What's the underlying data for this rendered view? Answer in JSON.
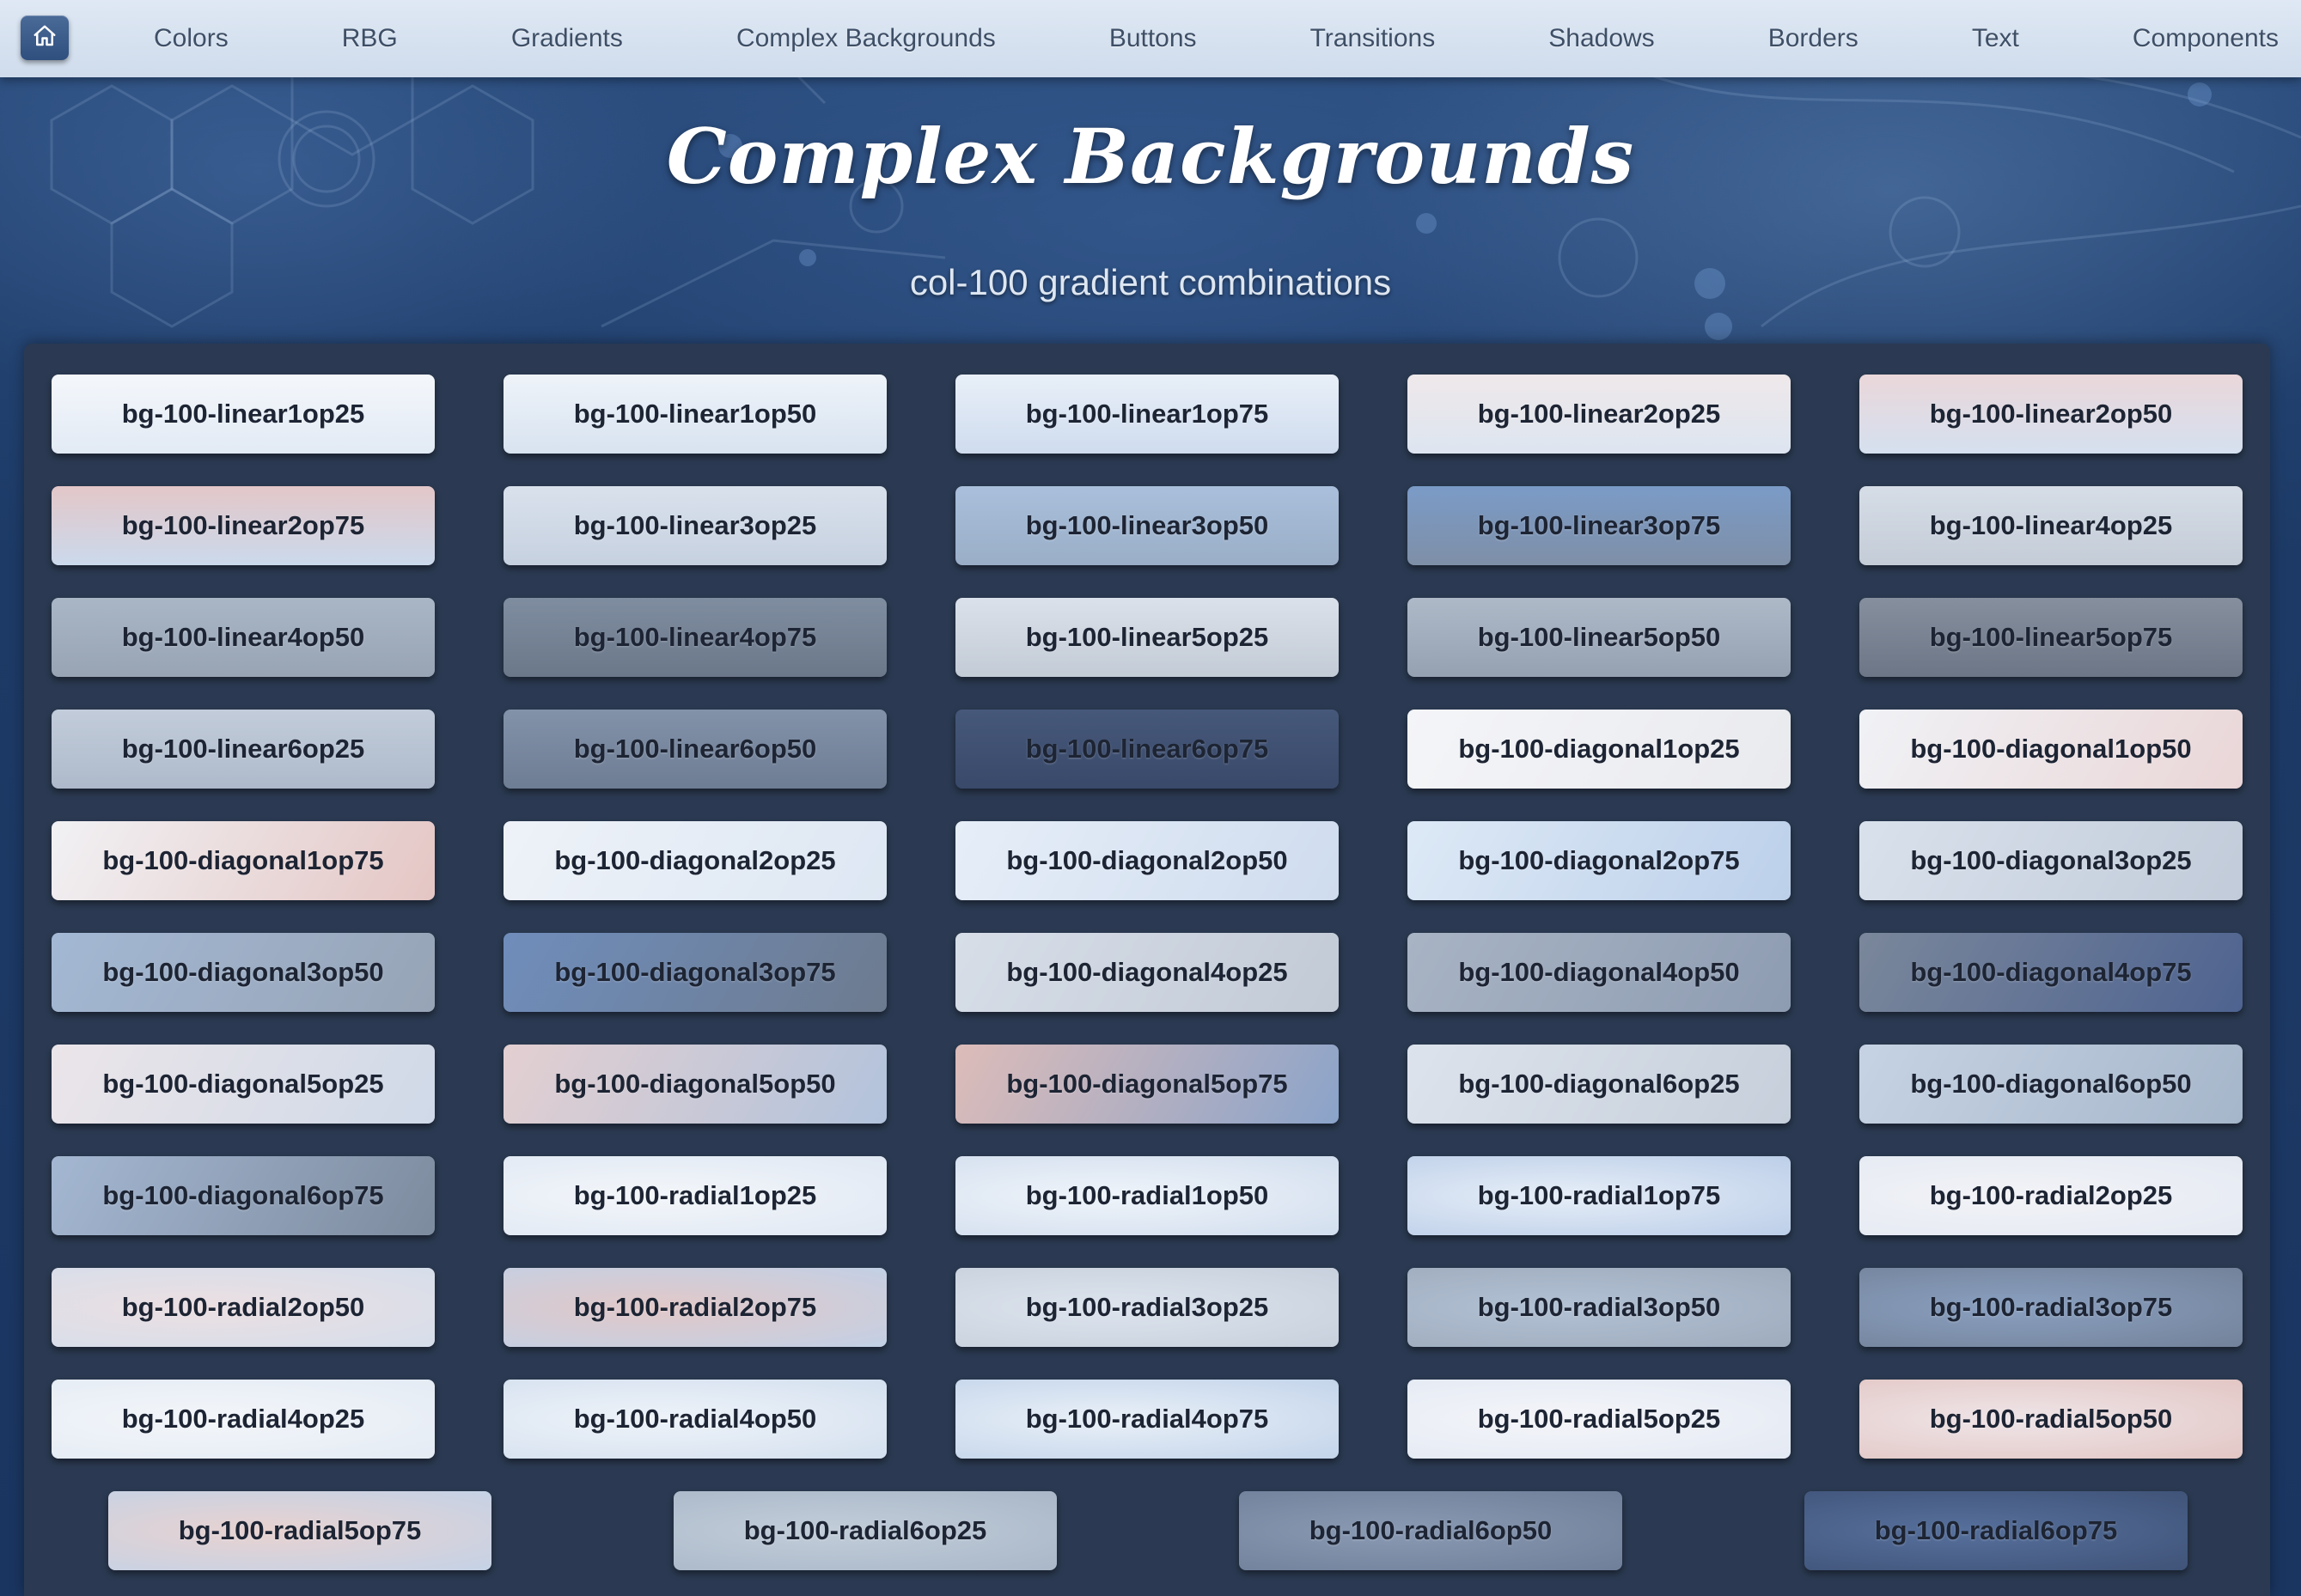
{
  "nav": {
    "home_icon": "home-icon",
    "items": [
      {
        "label": "Colors"
      },
      {
        "label": "RBG"
      },
      {
        "label": "Gradients"
      },
      {
        "label": "Complex Backgrounds"
      },
      {
        "label": "Buttons"
      },
      {
        "label": "Transitions"
      },
      {
        "label": "Shadows"
      },
      {
        "label": "Borders"
      },
      {
        "label": "Text"
      },
      {
        "label": "Components"
      }
    ]
  },
  "header": {
    "title": "Complex Backgrounds",
    "subtitle": "col-100 gradient combinations"
  },
  "colors": {
    "nav_bg": "#dfe8f4",
    "panel_bg": "#2b3a52",
    "page_bg": "#1f3a64"
  },
  "tiles": [
    {
      "label": "bg-100-linear1op25",
      "c1": "#f4f7fb",
      "c2": "#e2eaf4",
      "type": "linear"
    },
    {
      "label": "bg-100-linear1op50",
      "c1": "#eef3f9",
      "c2": "#d8e3f0",
      "type": "linear"
    },
    {
      "label": "bg-100-linear1op75",
      "c1": "#e8eff8",
      "c2": "#cfdcee",
      "type": "linear"
    },
    {
      "label": "bg-100-linear2op25",
      "c1": "#efe8ea",
      "c2": "#dde5f0",
      "type": "linear"
    },
    {
      "label": "bg-100-linear2op50",
      "c1": "#ead7da",
      "c2": "#d5e0ef",
      "type": "linear"
    },
    {
      "label": "bg-100-linear2op75",
      "c1": "#e3c7c8",
      "c2": "#cbd9ec",
      "type": "linear"
    },
    {
      "label": "bg-100-linear3op25",
      "c1": "#d9e1ec",
      "c2": "#c6d1e0",
      "type": "linear"
    },
    {
      "label": "bg-100-linear3op50",
      "c1": "#a9bfdb",
      "c2": "#9aaec7",
      "type": "linear"
    },
    {
      "label": "bg-100-linear3op75",
      "c1": "#7b9bc7",
      "c2": "#7e8fa7",
      "type": "linear"
    },
    {
      "label": "bg-100-linear4op25",
      "c1": "#d6dde7",
      "c2": "#c4ccd7",
      "type": "linear"
    },
    {
      "label": "bg-100-linear4op50",
      "c1": "#a9b6c6",
      "c2": "#98a4b4",
      "type": "linear"
    },
    {
      "label": "bg-100-linear4op75",
      "c1": "#7f8da0",
      "c2": "#6b788a",
      "type": "linear"
    },
    {
      "label": "bg-100-linear5op25",
      "c1": "#dbe1ea",
      "c2": "#c3cbd6",
      "type": "linear"
    },
    {
      "label": "bg-100-linear5op50",
      "c1": "#aeb9c8",
      "c2": "#95a1b1",
      "type": "linear"
    },
    {
      "label": "bg-100-linear5op75",
      "c1": "#858f9e",
      "c2": "#6c7686",
      "type": "linear"
    },
    {
      "label": "bg-100-linear6op25",
      "c1": "#c2ccda",
      "c2": "#aebacb",
      "type": "linear"
    },
    {
      "label": "bg-100-linear6op50",
      "c1": "#8292a9",
      "c2": "#6e7d94",
      "type": "linear"
    },
    {
      "label": "bg-100-linear6op75",
      "c1": "#46587a",
      "c2": "#39496a",
      "type": "linear"
    },
    {
      "label": "bg-100-diagonal1op25",
      "c1": "#f4f5f8",
      "c2": "#e9eaee",
      "type": "diagonal"
    },
    {
      "label": "bg-100-diagonal1op50",
      "c1": "#f0f2f6",
      "c2": "#ead6d7",
      "type": "diagonal"
    },
    {
      "label": "bg-100-diagonal1op75",
      "c1": "#f1f1f4",
      "c2": "#e4c6c4",
      "type": "diagonal"
    },
    {
      "label": "bg-100-diagonal2op25",
      "c1": "#eef2f8",
      "c2": "#dde7f3",
      "type": "diagonal"
    },
    {
      "label": "bg-100-diagonal2op50",
      "c1": "#e6eef8",
      "c2": "#cfdcee",
      "type": "diagonal"
    },
    {
      "label": "bg-100-diagonal2op75",
      "c1": "#dde9f6",
      "c2": "#bcd0ea",
      "type": "diagonal"
    },
    {
      "label": "bg-100-diagonal3op25",
      "c1": "#d9e1ec",
      "c2": "#c1cbd9",
      "type": "diagonal"
    },
    {
      "label": "bg-100-diagonal3op50",
      "c1": "#a3b8d4",
      "c2": "#97a4b6",
      "type": "diagonal"
    },
    {
      "label": "bg-100-diagonal3op75",
      "c1": "#6f8dbb",
      "c2": "#6d7b8f",
      "type": "diagonal"
    },
    {
      "label": "bg-100-diagonal4op25",
      "c1": "#d7dee8",
      "c2": "#c2cad6",
      "type": "diagonal"
    },
    {
      "label": "bg-100-diagonal4op50",
      "c1": "#a8b4c4",
      "c2": "#8e9cb2",
      "type": "diagonal"
    },
    {
      "label": "bg-100-diagonal4op75",
      "c1": "#7a879b",
      "c2": "#4e6390",
      "type": "diagonal"
    },
    {
      "label": "bg-100-diagonal5op25",
      "c1": "#ebe5e9",
      "c2": "#cfd9e8",
      "type": "diagonal"
    },
    {
      "label": "bg-100-diagonal5op50",
      "c1": "#e3cfd1",
      "c2": "#b2c3dc",
      "type": "diagonal"
    },
    {
      "label": "bg-100-diagonal5op75",
      "c1": "#ddbcb9",
      "c2": "#8aa3c9",
      "type": "diagonal"
    },
    {
      "label": "bg-100-diagonal6op25",
      "c1": "#dde3ec",
      "c2": "#c6cfdb",
      "type": "diagonal"
    },
    {
      "label": "bg-100-diagonal6op50",
      "c1": "#c6d3e4",
      "c2": "#a6b6ca",
      "type": "diagonal"
    },
    {
      "label": "bg-100-diagonal6op75",
      "c1": "#a4b7d2",
      "c2": "#7d8b9e",
      "type": "diagonal"
    },
    {
      "label": "bg-100-radial1op25",
      "c1": "#f3f6fa",
      "c2": "#e0e8f3",
      "type": "radial"
    },
    {
      "label": "bg-100-radial1op50",
      "c1": "#eff4fa",
      "c2": "#d2deee",
      "type": "radial"
    },
    {
      "label": "bg-100-radial1op75",
      "c1": "#e6eef8",
      "c2": "#bccee8",
      "type": "radial"
    },
    {
      "label": "bg-100-radial2op25",
      "c1": "#f2f3f7",
      "c2": "#e4e9f2",
      "type": "radial"
    },
    {
      "label": "bg-100-radial2op50",
      "c1": "#ecdfe2",
      "c2": "#d5deeb",
      "type": "radial"
    },
    {
      "label": "bg-100-radial2op75",
      "c1": "#e2c8c8",
      "c2": "#c2d0e5",
      "type": "radial"
    },
    {
      "label": "bg-100-radial3op25",
      "c1": "#dde4ee",
      "c2": "#c7d0dc",
      "type": "radial"
    },
    {
      "label": "bg-100-radial3op50",
      "c1": "#b2c1d4",
      "c2": "#9eabbd",
      "type": "radial"
    },
    {
      "label": "bg-100-radial3op75",
      "c1": "#8aa0c0",
      "c2": "#73829a",
      "type": "radial"
    },
    {
      "label": "bg-100-radial4op25",
      "c1": "#f3f6fa",
      "c2": "#e4ebf4",
      "type": "radial"
    },
    {
      "label": "bg-100-radial4op50",
      "c1": "#eef3f9",
      "c2": "#d4e0ef",
      "type": "radial"
    },
    {
      "label": "bg-100-radial4op75",
      "c1": "#e9f0f8",
      "c2": "#c3d4ea",
      "type": "radial"
    },
    {
      "label": "bg-100-radial5op25",
      "c1": "#f4f5f9",
      "c2": "#e3e9f3",
      "type": "radial"
    },
    {
      "label": "bg-100-radial5op50",
      "c1": "#efe5e8",
      "c2": "#e2c6c4",
      "type": "radial"
    }
  ],
  "last_row": [
    {
      "label": "bg-100-radial5op75",
      "c1": "#e8d2d0",
      "c2": "#c4d2e6",
      "type": "radial"
    },
    {
      "label": "bg-100-radial6op25",
      "c1": "#c2cdd9",
      "c2": "#a9b7c8",
      "type": "radial"
    },
    {
      "label": "bg-100-radial6op50",
      "c1": "#8a9ab3",
      "c2": "#6f7f99",
      "type": "radial"
    },
    {
      "label": "bg-100-radial6op75",
      "c1": "#56709c",
      "c2": "#405378",
      "type": "radial"
    }
  ]
}
